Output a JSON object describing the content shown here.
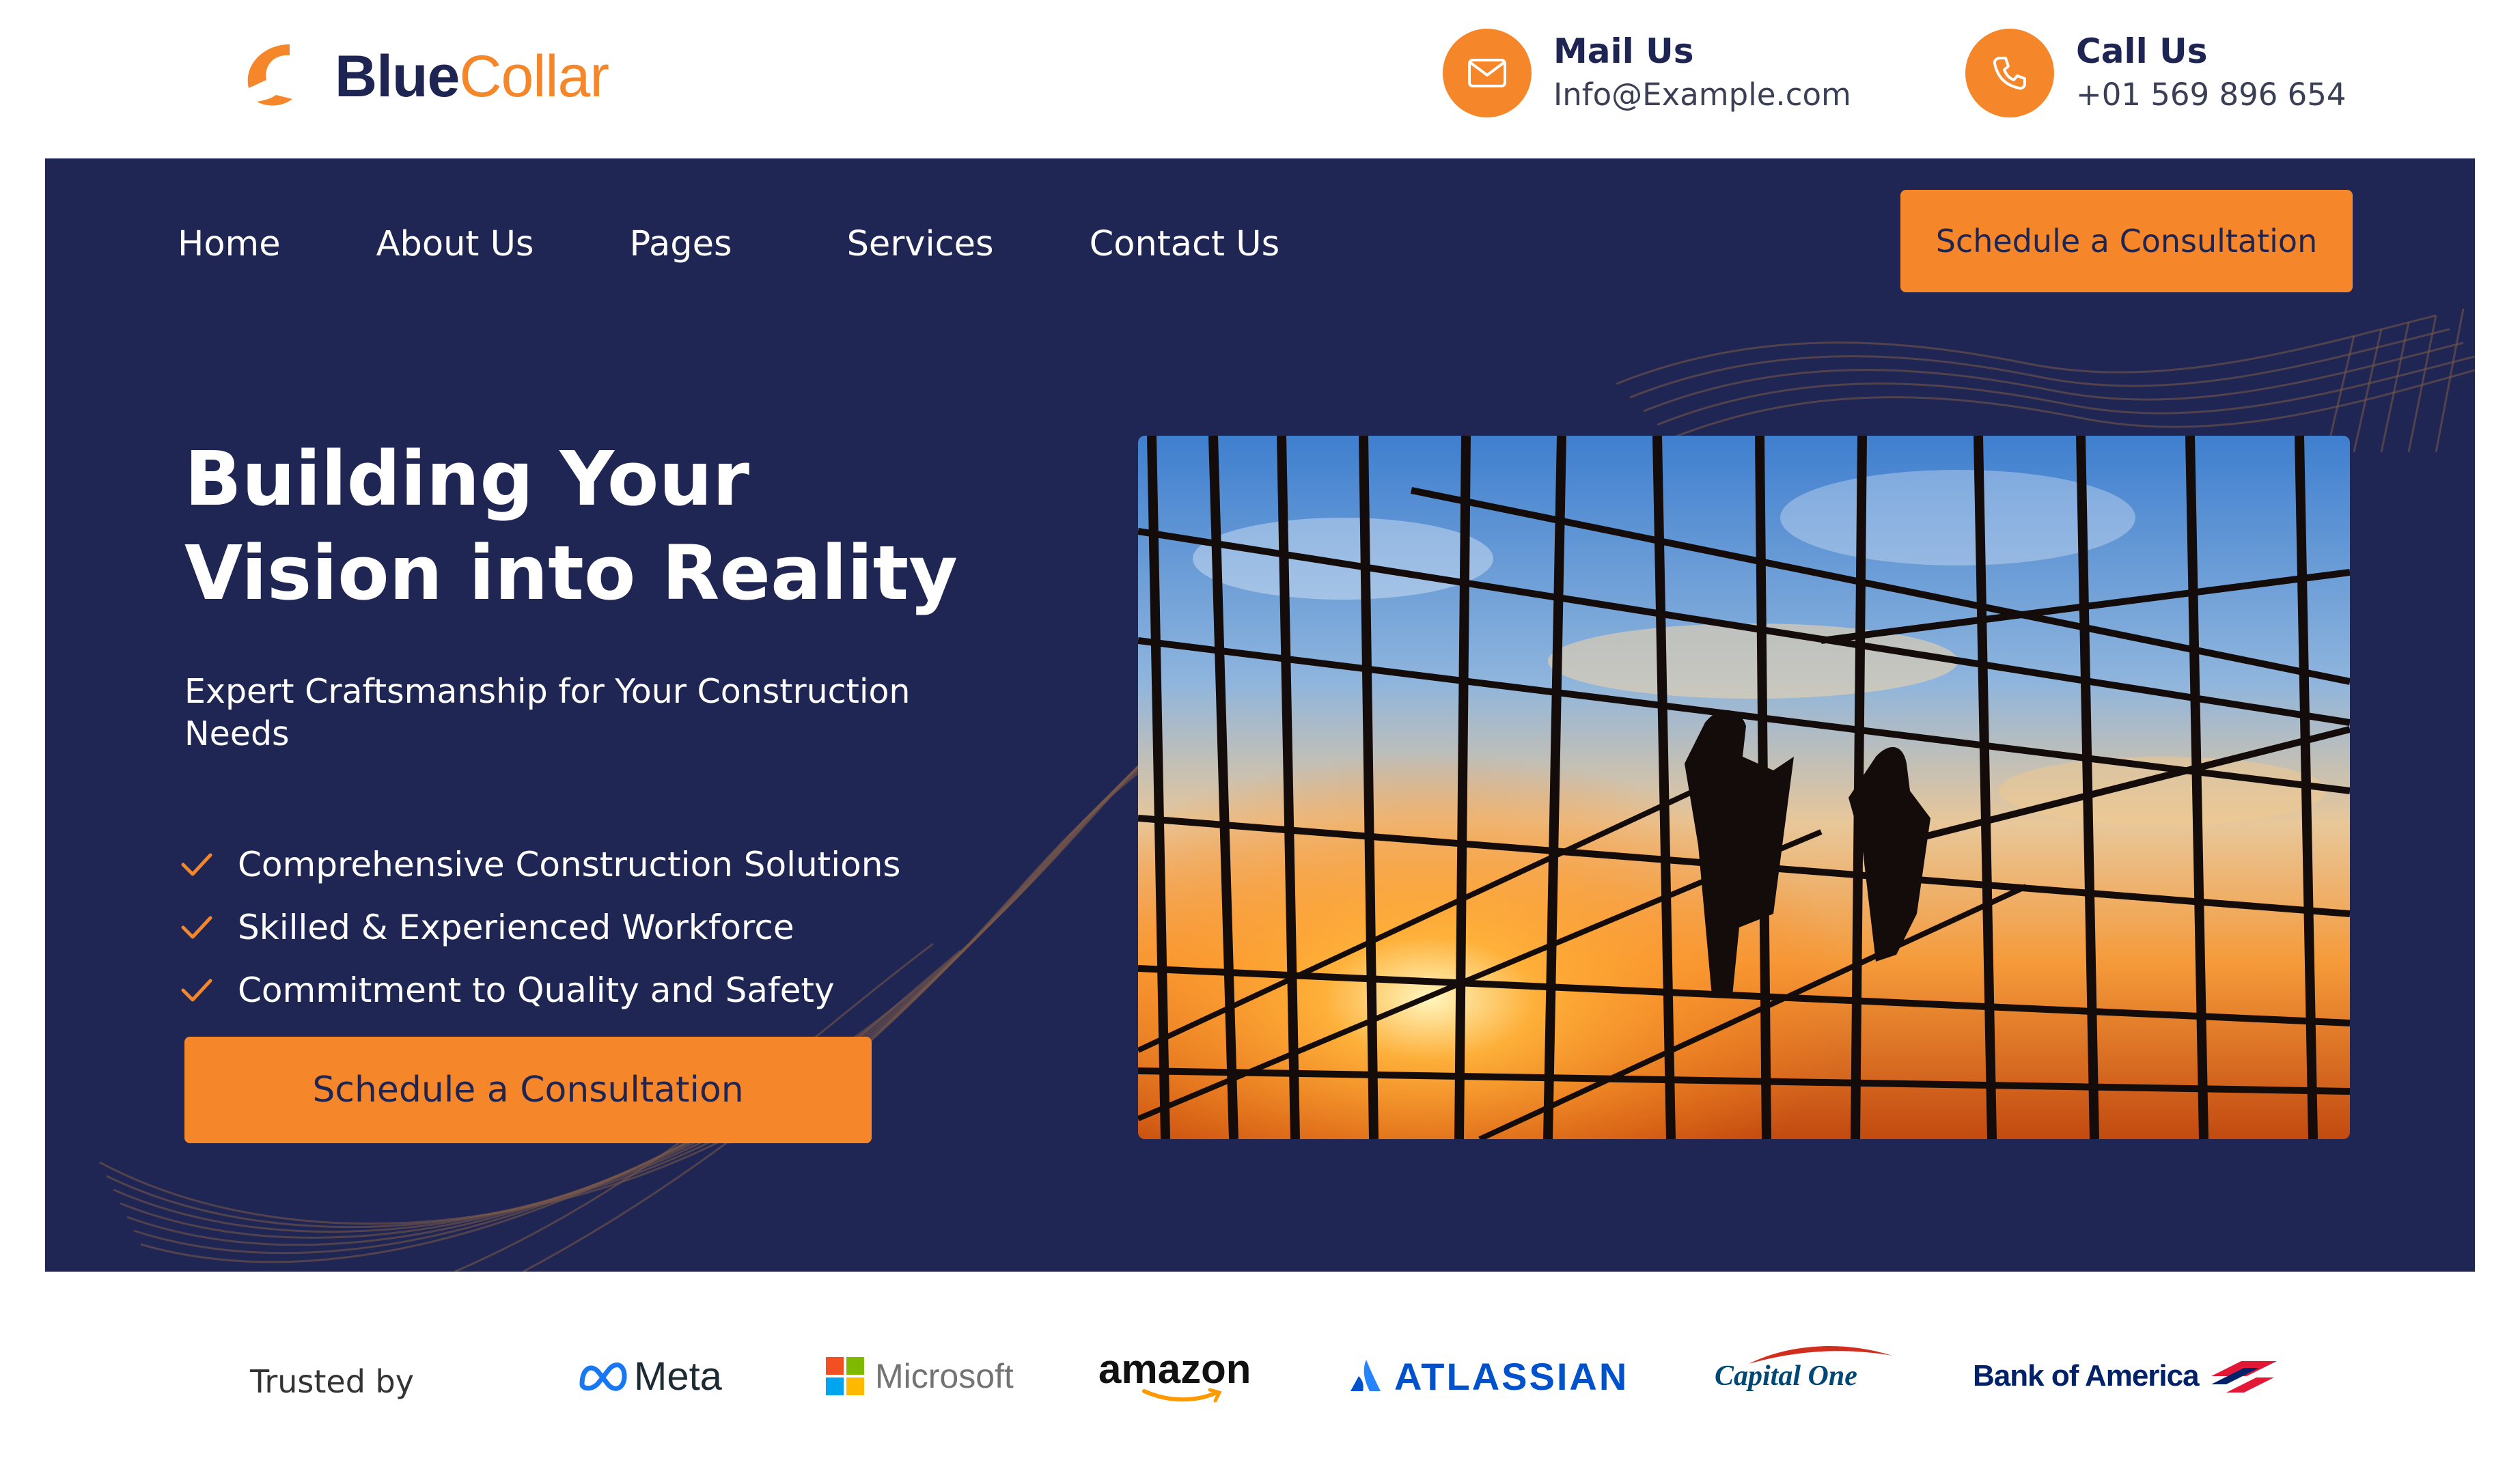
{
  "brand": {
    "name_part1": "Blue",
    "name_part2": "Collar",
    "logo_icon": "crescent-logo-icon"
  },
  "header": {
    "mail": {
      "title": "Mail Us",
      "value": "Info@Example.com",
      "icon": "mail-icon"
    },
    "call": {
      "title": "Call Us",
      "value": "+01 569 896 654",
      "icon": "phone-icon"
    }
  },
  "nav": {
    "items": [
      {
        "label": "Home"
      },
      {
        "label": "About Us"
      },
      {
        "label": "Pages"
      },
      {
        "label": "Services"
      },
      {
        "label": "Contact Us"
      }
    ],
    "cta_label": "Schedule a Consultation"
  },
  "hero": {
    "headline_line1": "Building Your",
    "headline_line2": "Vision into Reality",
    "subtitle": "Expert Craftsmanship for Your Construction Needs",
    "features": [
      "Comprehensive Construction Solutions",
      "Skilled & Experienced Workforce",
      "Commitment to Quality and Safety"
    ],
    "cta_label": "Schedule a Consultation",
    "image_alt": "construction-scaffolding-sunset-photo"
  },
  "trusted": {
    "label": "Trusted by",
    "logos": [
      "Meta",
      "Microsoft",
      "amazon",
      "ATLASSIAN",
      "Capital One",
      "Bank of America"
    ]
  },
  "colors": {
    "accent": "#f5862a",
    "navy": "#1f2653",
    "white": "#ffffff"
  }
}
